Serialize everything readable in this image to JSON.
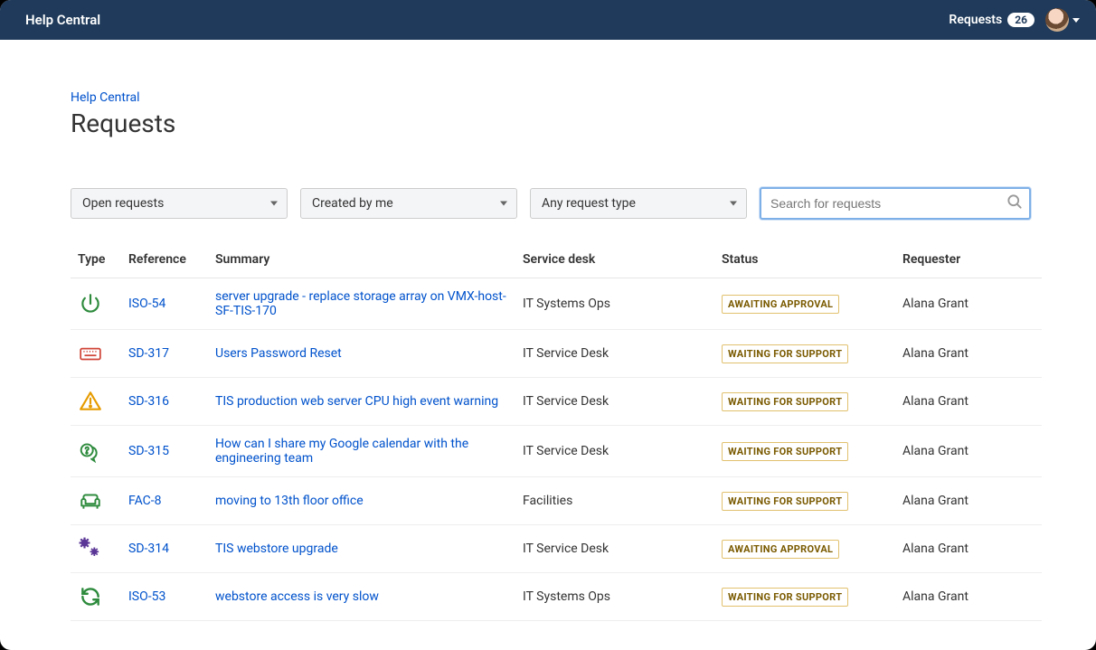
{
  "topbar": {
    "app_title": "Help Central",
    "requests_label": "Requests",
    "requests_count": "26"
  },
  "breadcrumb": {
    "parent": "Help Central"
  },
  "page": {
    "title": "Requests"
  },
  "filters": {
    "status": "Open requests",
    "creator": "Created by me",
    "request_type": "Any request type",
    "search_placeholder": "Search for requests"
  },
  "table": {
    "headers": {
      "type": "Type",
      "reference": "Reference",
      "summary": "Summary",
      "service_desk": "Service desk",
      "status": "Status",
      "requester": "Requester"
    },
    "rows": [
      {
        "icon": "power-icon",
        "icon_color": "#2e8b3d",
        "reference": "ISO-54",
        "summary": "server upgrade - replace storage array on VMX-host-SF-TIS-170",
        "service_desk": "IT Systems Ops",
        "status": "AWAITING APPROVAL",
        "requester": "Alana Grant"
      },
      {
        "icon": "keyboard-icon",
        "icon_color": "#d04437",
        "reference": "SD-317",
        "summary": "Users Password Reset",
        "service_desk": "IT Service Desk",
        "status": "WAITING FOR SUPPORT",
        "requester": "Alana Grant"
      },
      {
        "icon": "warning-icon",
        "icon_color": "#e69b00",
        "reference": "SD-316",
        "summary": "TIS production web server CPU high event warning",
        "service_desk": "IT Service Desk",
        "status": "WAITING FOR SUPPORT",
        "requester": "Alana Grant"
      },
      {
        "icon": "question-bubble-icon",
        "icon_color": "#2e8b3d",
        "reference": "SD-315",
        "summary": "How can I share my Google calendar with the engineering team",
        "service_desk": "IT Service Desk",
        "status": "WAITING FOR SUPPORT",
        "requester": "Alana Grant"
      },
      {
        "icon": "couch-icon",
        "icon_color": "#2e8b3d",
        "reference": "FAC-8",
        "summary": "moving to 13th floor office",
        "service_desk": "Facilities",
        "status": "WAITING FOR SUPPORT",
        "requester": "Alana Grant"
      },
      {
        "icon": "gears-icon",
        "icon_color": "#5a3696",
        "reference": "SD-314",
        "summary": "TIS webstore upgrade",
        "service_desk": "IT Service Desk",
        "status": "AWAITING APPROVAL",
        "requester": "Alana Grant"
      },
      {
        "icon": "refresh-icon",
        "icon_color": "#2e8b3d",
        "reference": "ISO-53",
        "summary": "webstore access is very slow",
        "service_desk": "IT Systems Ops",
        "status": "WAITING FOR SUPPORT",
        "requester": "Alana Grant"
      }
    ]
  }
}
